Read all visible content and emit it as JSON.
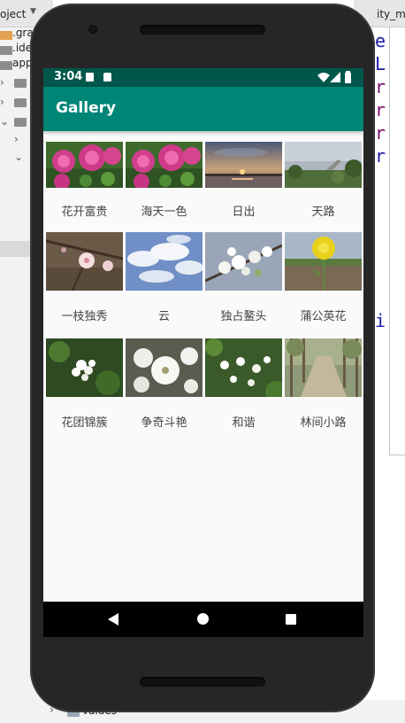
{
  "ide": {
    "project_label": "oject",
    "tree": [
      ".gra",
      ".ide",
      "app"
    ],
    "bottom_item": "values",
    "code_chars": [
      "e",
      "L",
      "r",
      "r",
      "r",
      "r",
      "i"
    ],
    "tab_label": "ity_m"
  },
  "status_bar": {
    "time": "3:04",
    "icons": [
      "a-notification-icon",
      "sd-card-icon",
      "wifi-icon",
      "signal-icon",
      "battery-icon"
    ]
  },
  "app_bar": {
    "title": "Gallery"
  },
  "gallery": {
    "items": [
      {
        "label": "花开富贵",
        "image": "peony-flowers"
      },
      {
        "label": "海天一色",
        "image": "peony-flowers"
      },
      {
        "label": "日出",
        "image": "sunrise-lake"
      },
      {
        "label": "天路",
        "image": "lakeside-road"
      },
      {
        "label": "一枝独秀",
        "image": "single-blossom"
      },
      {
        "label": "云",
        "image": "clouds-sky"
      },
      {
        "label": "独占鳌头",
        "image": "pear-blossom-branch"
      },
      {
        "label": "蒲公英花",
        "image": "dandelion"
      },
      {
        "label": "花团锦簇",
        "image": "white-blossom-cluster"
      },
      {
        "label": "争奇斗艳",
        "image": "white-blossom-closeup"
      },
      {
        "label": "和谐",
        "image": "white-blossoms-green"
      },
      {
        "label": "林间小路",
        "image": "forest-path"
      }
    ]
  },
  "nav_bar": {
    "buttons": [
      "back",
      "home",
      "recents"
    ]
  },
  "colors": {
    "status_bar": "#00574b",
    "app_bar": "#008577",
    "screen_bg": "#fafafa"
  }
}
